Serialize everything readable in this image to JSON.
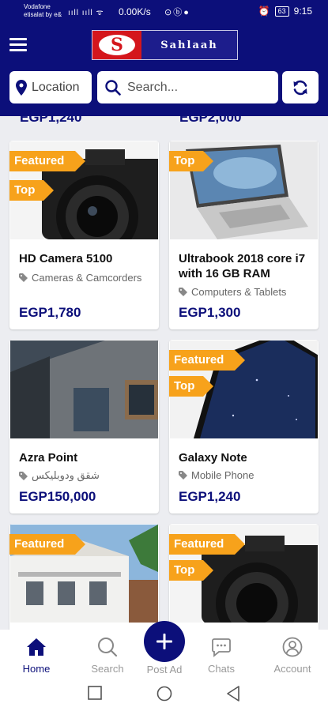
{
  "statusbar": {
    "carrier_line1": "Vodafone",
    "carrier_line2": "etisalat by e&",
    "signals": "ııll ııll ᯤ",
    "speed": "0.00K/s",
    "icons": "⊙ⓑ●",
    "alarm": "⏰",
    "battery": "63",
    "time": "9:15"
  },
  "header": {
    "logo_letter": "S",
    "logo_text": "Sahlaah",
    "location_label": "Location",
    "search_placeholder": "Search..."
  },
  "partial_prices": [
    "EGP1,240",
    "EGP2,000"
  ],
  "tags": {
    "featured": "Featured",
    "top": "Top"
  },
  "listings": [
    {
      "title": "HD Camera 5100",
      "category": "Cameras & Camcorders",
      "price": "EGP1,780",
      "featured": true,
      "top": true
    },
    {
      "title": "Ultrabook 2018 core i7 with 16 GB RAM",
      "category": "Computers & Tablets",
      "price": "EGP1,300",
      "featured": false,
      "top": true
    },
    {
      "title": "Azra Point",
      "category": "شقق ودوبليكس",
      "price": "EGP150,000",
      "featured": false,
      "top": false
    },
    {
      "title": "Galaxy Note",
      "category": "Mobile Phone",
      "price": "EGP1,240",
      "featured": true,
      "top": true
    },
    {
      "title": "",
      "category": "",
      "price": "",
      "featured": true,
      "top": false
    },
    {
      "title": "",
      "category": "",
      "price": "",
      "featured": true,
      "top": true
    }
  ],
  "nav": {
    "home": "Home",
    "search": "Search",
    "post_ad": "Post Ad",
    "chats": "Chats",
    "account": "Account"
  },
  "colors": {
    "brand": "#0c0f7a",
    "accent": "#f7a21b",
    "logo_red": "#d4161c"
  },
  "icons": {
    "menu": "hamburger-icon",
    "location": "map-pin-icon",
    "search": "search-icon",
    "refresh": "refresh-icon",
    "category": "tag-icon",
    "home": "home-icon",
    "post": "plus-icon",
    "chats": "chat-bubble-icon",
    "account": "user-icon"
  }
}
